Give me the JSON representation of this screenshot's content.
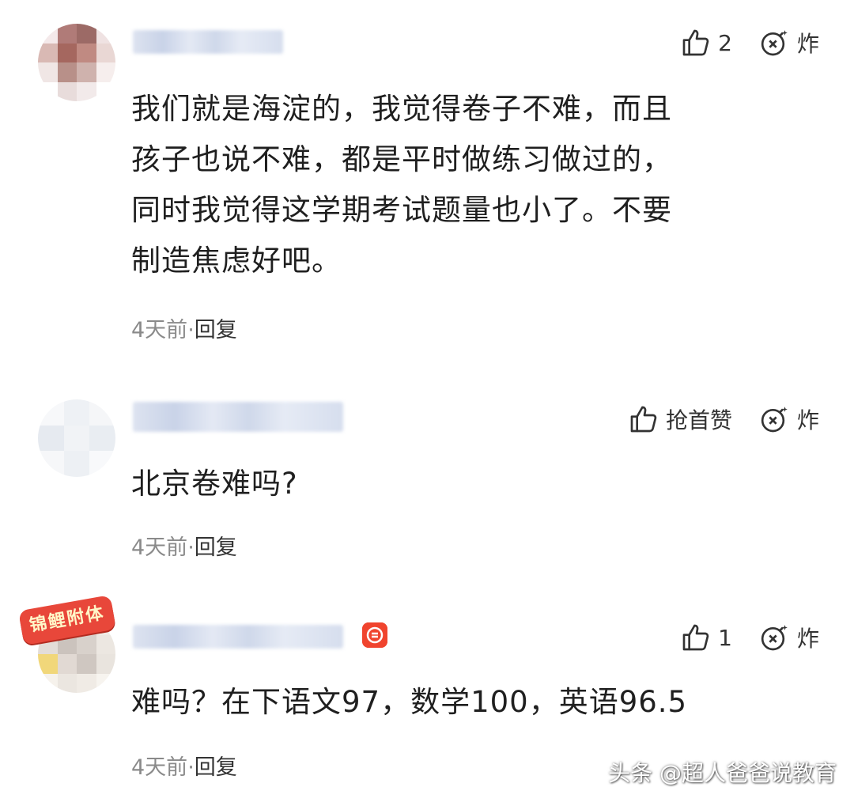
{
  "comments": [
    {
      "like_count": "2",
      "bomb_label": "炸",
      "text_lines": [
        "我们就是海淀的，我觉得卷子不难，而且",
        "孩子也说不难，都是平时做练习做过的，",
        "同时我觉得这学期考试题量也小了。不要",
        "制造焦虑好吧。"
      ],
      "time": "4天前",
      "separator": "·",
      "reply": "回复"
    },
    {
      "like_count": "抢首赞",
      "bomb_label": "炸",
      "text_lines": [
        "北京卷难吗?"
      ],
      "time": "4天前",
      "separator": "·",
      "reply": "回复"
    },
    {
      "like_count": "1",
      "bomb_label": "炸",
      "badge": "锦鲤附体",
      "text_lines": [
        "难吗？在下语文97，数学100，英语96.5"
      ],
      "time": "4天前",
      "separator": "·",
      "reply": "回复"
    }
  ],
  "icons": {
    "like": "thumbs-up-icon",
    "bomb": "bomb-icon",
    "vip": "vip-badge-icon"
  },
  "watermark": "头条 @超人爸爸说教育"
}
